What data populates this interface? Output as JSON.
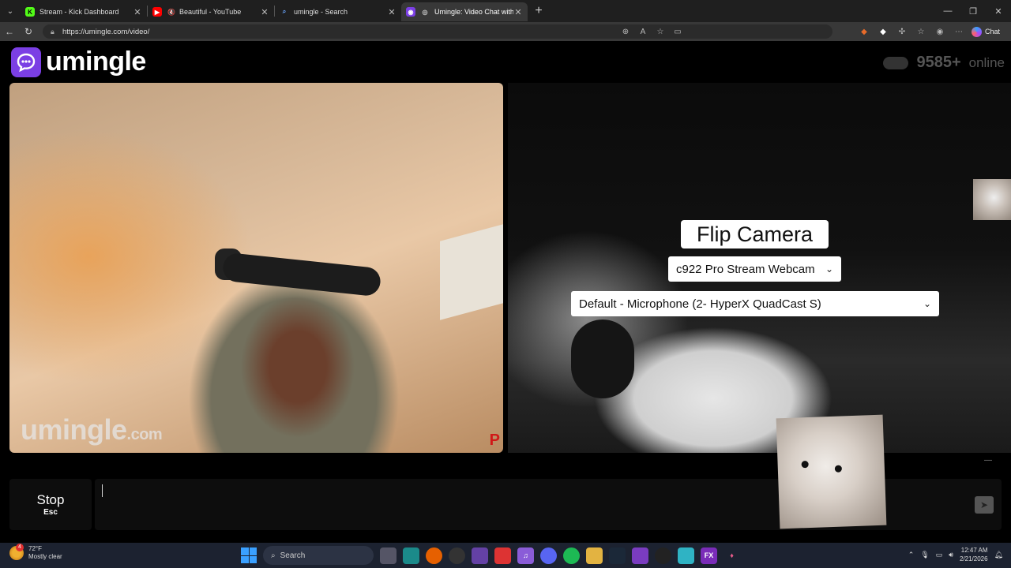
{
  "browser": {
    "tabs": [
      {
        "title": "Stream - Kick Dashboard",
        "icon": "kick-icon",
        "active": false
      },
      {
        "title": "Beautiful - YouTube",
        "icon": "youtube-icon",
        "active": false
      },
      {
        "title": "umingle - Search",
        "icon": "search-icon",
        "active": false
      },
      {
        "title": "Umingle: Video Chat with Stra",
        "icon": "umingle-icon",
        "active": true
      }
    ],
    "url": "https://umingle.com/video/",
    "chat_label": "Chat"
  },
  "site": {
    "logo_text": "umingle",
    "online_count": "9585+",
    "online_label": "online",
    "watermark_main": "umingle",
    "watermark_suffix": ".com",
    "watermark_flag": "P",
    "flip_camera_label": "Flip Camera",
    "camera_select_value": "c922 Pro Stream Webcam",
    "mic_select_value": "Default - Microphone (2- HyperX QuadCast S)",
    "stop_label": "Stop",
    "stop_key": "Esc",
    "message_placeholder": ""
  },
  "taskbar": {
    "weather_temp": "72°F",
    "weather_desc": "Mostly clear",
    "weather_badge": "4",
    "search_label": "Search",
    "time": "12:47 AM",
    "date": "2/21/2026"
  },
  "colors": {
    "brand": "#7b3fe4",
    "page_bg": "#000000",
    "taskbar_bg": "#1c2230"
  }
}
